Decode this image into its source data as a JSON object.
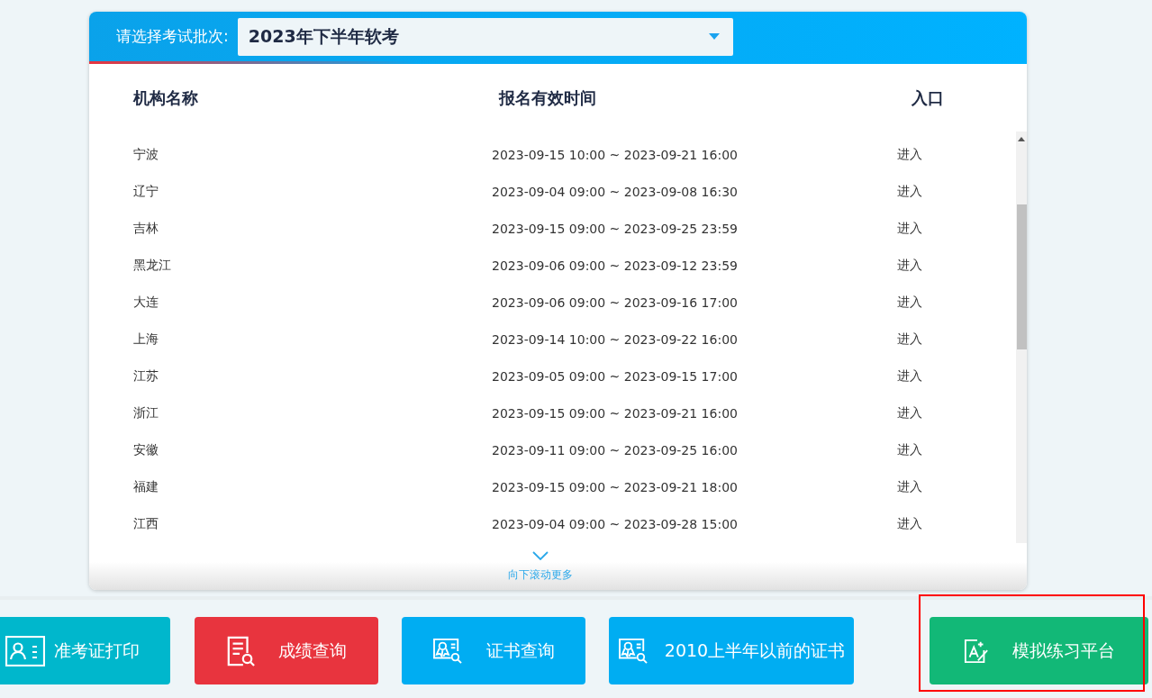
{
  "batch_selector": {
    "label": "请选择考试批次:",
    "value": "2023年下半年软考"
  },
  "table": {
    "columns": [
      "机构名称",
      "报名有效时间",
      "入口"
    ],
    "rows": [
      {
        "name": "宁波",
        "time": "2023-09-15 10:00 ~ 2023-09-21 16:00",
        "entry": "进入"
      },
      {
        "name": "辽宁",
        "time": "2023-09-04 09:00 ~ 2023-09-08 16:30",
        "entry": "进入"
      },
      {
        "name": "吉林",
        "time": "2023-09-15 09:00 ~ 2023-09-25 23:59",
        "entry": "进入"
      },
      {
        "name": "黑龙江",
        "time": "2023-09-06 09:00 ~ 2023-09-12 23:59",
        "entry": "进入"
      },
      {
        "name": "大连",
        "time": "2023-09-06 09:00 ~ 2023-09-16 17:00",
        "entry": "进入"
      },
      {
        "name": "上海",
        "time": "2023-09-14 10:00 ~ 2023-09-22 16:00",
        "entry": "进入"
      },
      {
        "name": "江苏",
        "time": "2023-09-05 09:00 ~ 2023-09-15 17:00",
        "entry": "进入"
      },
      {
        "name": "浙江",
        "time": "2023-09-15 09:00 ~ 2023-09-21 16:00",
        "entry": "进入"
      },
      {
        "name": "安徽",
        "time": "2023-09-11 09:00 ~ 2023-09-25 16:00",
        "entry": "进入"
      },
      {
        "name": "福建",
        "time": "2023-09-15 09:00 ~ 2023-09-21 18:00",
        "entry": "进入"
      },
      {
        "name": "江西",
        "time": "2023-09-04 09:00 ~ 2023-09-28 15:00",
        "entry": "进入"
      }
    ],
    "more_hint": "向下滚动更多"
  },
  "shortcuts": [
    {
      "kind": "admission",
      "label": "准考证打印",
      "color": "#00b7cc",
      "highlighted": false
    },
    {
      "kind": "score",
      "label": "成绩查询",
      "color": "#e8343e",
      "highlighted": false
    },
    {
      "kind": "certificate",
      "label": "证书查询",
      "color": "#00adf2",
      "highlighted": false
    },
    {
      "kind": "certificate",
      "label": "2010上半年以前的证书",
      "color": "#00adf2",
      "highlighted": false
    },
    {
      "kind": "practice",
      "label": "模拟练习平台",
      "color": "#12b877",
      "highlighted": true
    }
  ]
}
